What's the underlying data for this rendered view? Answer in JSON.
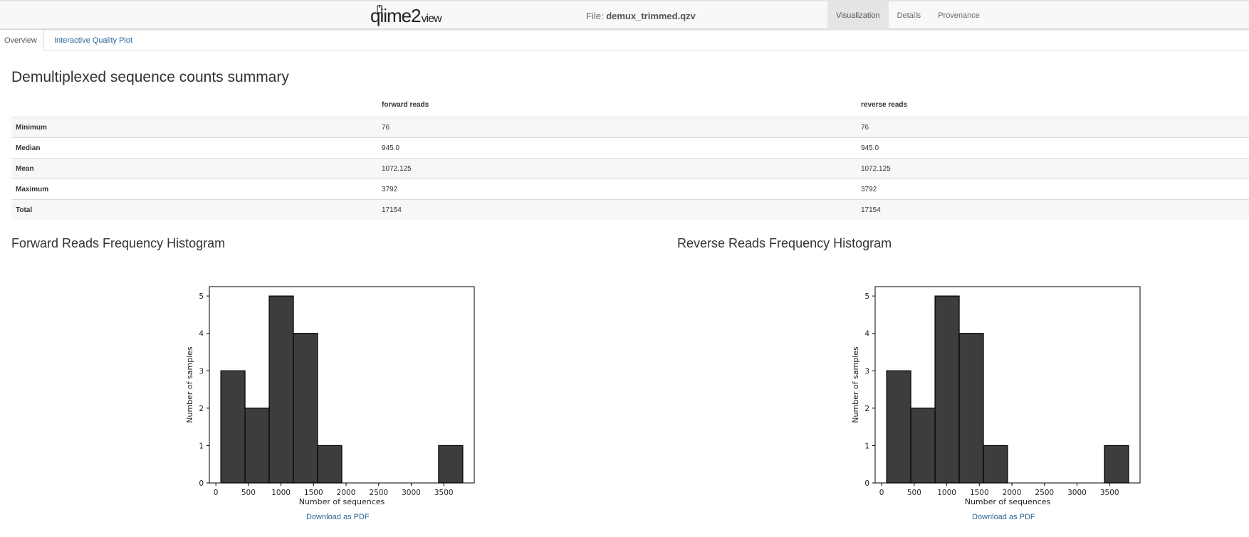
{
  "header": {
    "logo_main": "qiime2",
    "logo_sub": "view",
    "file_label": "File:",
    "file_name": "demux_trimmed.qzv",
    "nav": [
      {
        "label": "Visualization"
      },
      {
        "label": "Details"
      },
      {
        "label": "Provenance"
      }
    ]
  },
  "tabs": [
    {
      "label": "Overview"
    },
    {
      "label": "Interactive Quality Plot"
    }
  ],
  "summary": {
    "title": "Demultiplexed sequence counts summary",
    "columns": [
      "forward reads",
      "reverse reads"
    ],
    "rows": [
      {
        "label": "Minimum",
        "forward": "76",
        "reverse": "76"
      },
      {
        "label": "Median",
        "forward": "945.0",
        "reverse": "945.0"
      },
      {
        "label": "Mean",
        "forward": "1072.125",
        "reverse": "1072.125"
      },
      {
        "label": "Maximum",
        "forward": "3792",
        "reverse": "3792"
      },
      {
        "label": "Total",
        "forward": "17154",
        "reverse": "17154"
      }
    ]
  },
  "histograms": [
    {
      "title": "Forward Reads Frequency Histogram",
      "download_label": "Download as PDF"
    },
    {
      "title": "Reverse Reads Frequency Histogram",
      "download_label": "Download as PDF"
    }
  ],
  "chart_data": [
    {
      "type": "bar",
      "title": "",
      "xlabel": "Number of sequences",
      "ylabel": "Number of samples",
      "bin_edges": [
        76,
        447.6,
        819.2,
        1190.8,
        1562.4,
        1934,
        2305.6,
        2677.2,
        3048.8,
        3420.4,
        3792
      ],
      "values": [
        3,
        2,
        5,
        4,
        1,
        0,
        0,
        0,
        0,
        1
      ],
      "xlim": [
        -100,
        3968
      ],
      "ylim": [
        0,
        5.25
      ],
      "xticks": [
        0,
        500,
        1000,
        1500,
        2000,
        2500,
        3000,
        3500
      ],
      "yticks": [
        0,
        1,
        2,
        3,
        4,
        5
      ],
      "bar_color": "#3d3d3d"
    },
    {
      "type": "bar",
      "title": "",
      "xlabel": "Number of sequences",
      "ylabel": "Number of samples",
      "bin_edges": [
        76,
        447.6,
        819.2,
        1190.8,
        1562.4,
        1934,
        2305.6,
        2677.2,
        3048.8,
        3420.4,
        3792
      ],
      "values": [
        3,
        2,
        5,
        4,
        1,
        0,
        0,
        0,
        0,
        1
      ],
      "xlim": [
        -100,
        3968
      ],
      "ylim": [
        0,
        5.25
      ],
      "xticks": [
        0,
        500,
        1000,
        1500,
        2000,
        2500,
        3000,
        3500
      ],
      "yticks": [
        0,
        1,
        2,
        3,
        4,
        5
      ],
      "bar_color": "#3d3d3d"
    }
  ]
}
